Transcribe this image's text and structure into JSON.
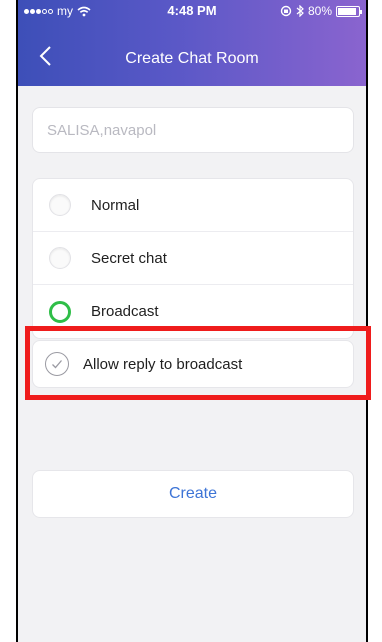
{
  "status_bar": {
    "carrier": "my",
    "time": "4:48 PM",
    "battery": "80%"
  },
  "nav": {
    "title": "Create Chat Room"
  },
  "members_field": {
    "value": "SALISA,navapol"
  },
  "room_types": [
    {
      "label": "Normal",
      "selected": false
    },
    {
      "label": "Secret chat",
      "selected": false
    },
    {
      "label": "Broadcast",
      "selected": true
    }
  ],
  "allow_reply": {
    "label": "Allow reply to broadcast",
    "checked": false
  },
  "create_button": {
    "label": "Create"
  },
  "colors": {
    "accent_blue": "#3d74d6",
    "selected_green": "#2fbe48",
    "highlight_red": "#ef1c1c",
    "header_start": "#3d4fb8",
    "header_end": "#8a64cf"
  }
}
